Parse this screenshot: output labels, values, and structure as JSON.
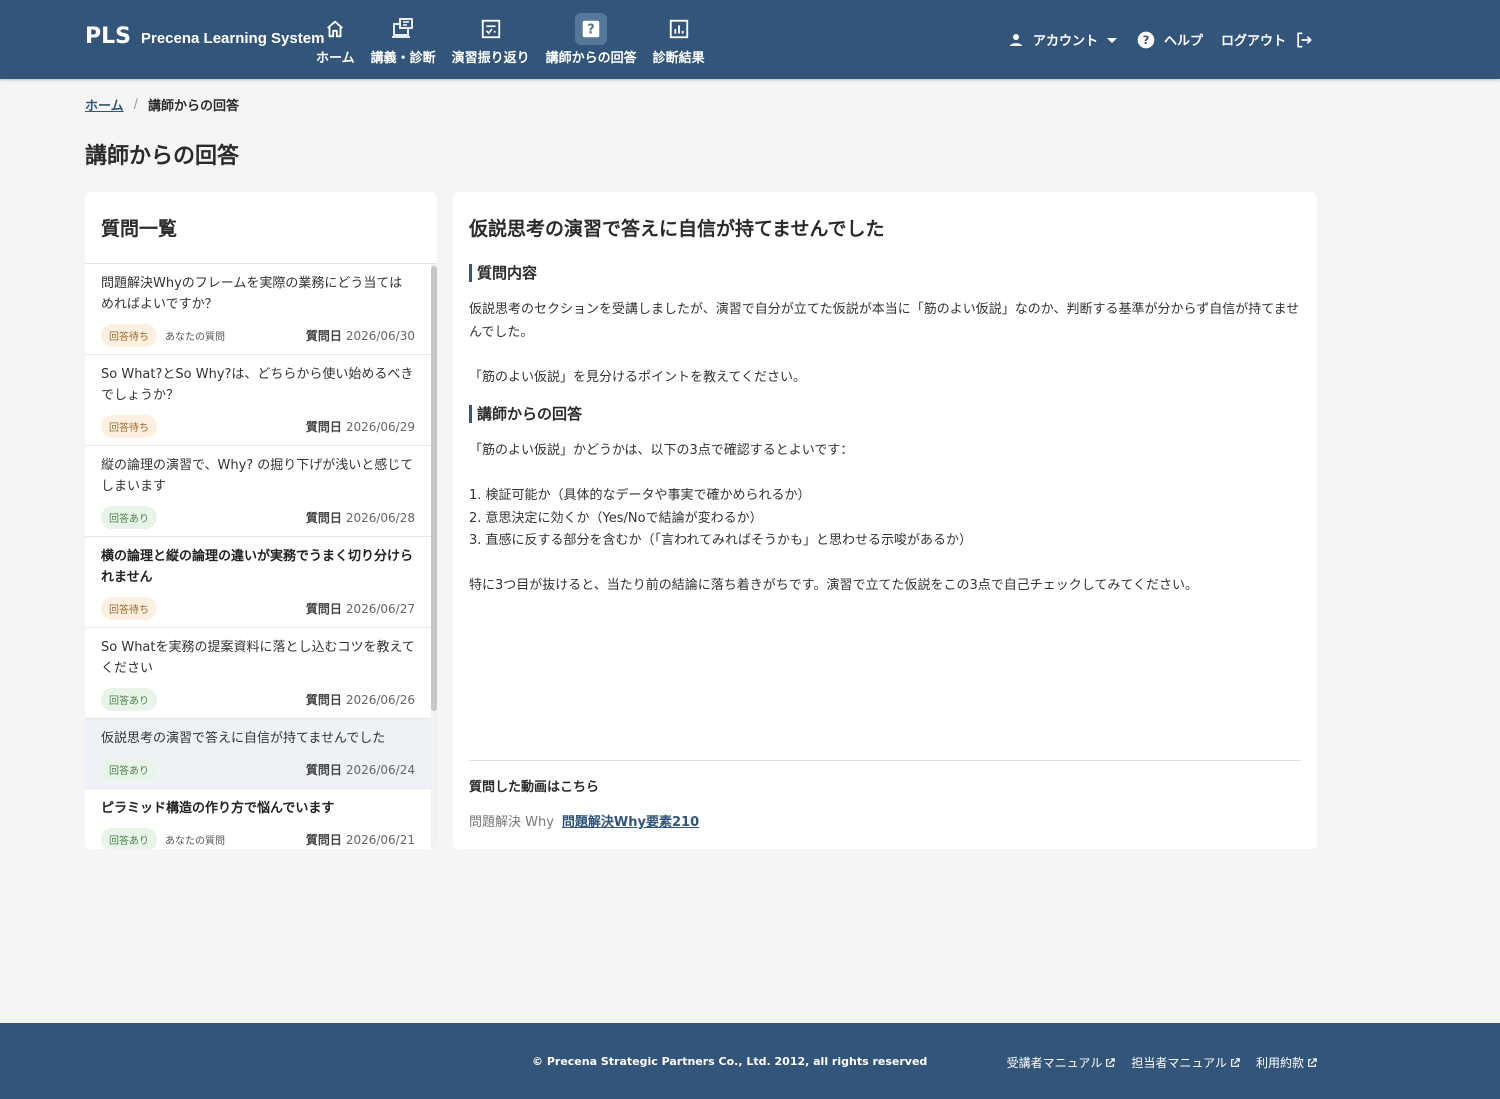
{
  "header": {
    "logo_mark": "PLS",
    "logo_text": "Precena Learning System",
    "nav": [
      {
        "label": "ホーム",
        "icon": "home-icon"
      },
      {
        "label": "講義・診断",
        "icon": "lecture-icon"
      },
      {
        "label": "演習振り返り",
        "icon": "exercise-review-icon"
      },
      {
        "label": "講師からの回答",
        "icon": "question-icon"
      },
      {
        "label": "診断結果",
        "icon": "chart-icon"
      }
    ],
    "active_nav": "講師からの回答",
    "account_label": "アカウント",
    "help_label": "ヘルプ",
    "logout_label": "ログアウト"
  },
  "breadcrumb": {
    "home": "ホーム",
    "sep": "/",
    "current": "講師からの回答"
  },
  "page_title": "講師からの回答",
  "list": {
    "title": "質問一覧",
    "date_label": "質問日",
    "items": [
      {
        "title": "問題解決Whyのフレームを実際の業務にどう当てはめればよいですか？",
        "status": "回答待ち",
        "yours": "あなたの質問",
        "date": "2026/06/30"
      },
      {
        "title": "So What?とSo Why?は、どちらから使い始めるべきでしょうか？",
        "status": "回答待ち",
        "date": "2026/06/29"
      },
      {
        "title": "縦の論理の演習で、Why? の掘り下げが浅いと感じてしまいます",
        "status": "回答あり",
        "date": "2026/06/28"
      },
      {
        "title": "横の論理と縦の論理の違いが実務でうまく切り分けられません",
        "status": "回答待ち",
        "date": "2026/06/27"
      },
      {
        "title": "So Whatを実務の提案資料に落とし込むコツを教えてください",
        "status": "回答あり",
        "date": "2026/06/26"
      },
      {
        "title": "仮説思考の演習で答えに自信が持てませんでした",
        "status": "回答あり",
        "date": "2026/06/24"
      },
      {
        "title": "ピラミッド構造の作り方で悩んでいます",
        "status": "回答あり",
        "yours": "あなたの質問",
        "date": "2026/06/21"
      }
    ]
  },
  "detail": {
    "title": "仮説思考の演習で答えに自信が持てませんでした",
    "question_heading": "質問内容",
    "question_body": "仮説思考のセクションを受講しましたが、演習で自分が立てた仮説が本当に「筋のよい仮説」なのか、判断する基準が分からず自信が持てませんでした。\n\n「筋のよい仮説」を見分けるポイントを教えてください。",
    "answer_heading": "講師からの回答",
    "answer_body": "「筋のよい仮説」かどうかは、以下の3点で確認するとよいです：\n\n1. 検証可能か（具体的なデータや事実で確かめられるか）\n2. 意思決定に効くか（Yes/Noで結論が変わるか）\n3. 直感に反する部分を含むか（「言われてみればそうかも」と思わせる示唆があるか）\n\n特に3つ目が抜けると、当たり前の結論に落ち着きがちです。演習で立てた仮説をこの3点で自己チェックしてみてください。",
    "video_heading": "質問した動画はこちら",
    "video_category": "問題解決 Why",
    "video_link": "問題解決Why要素210"
  },
  "footer": {
    "copyright": "© Precena Strategic Partners Co., Ltd. 2012, all rights reserved",
    "links": [
      "受講者マニュアル",
      "担当者マニュアル",
      "利用約款"
    ]
  },
  "colors": {
    "primary": "#33557a",
    "wait_badge": "#fdf0e1",
    "done_badge": "#e8f4e8"
  }
}
